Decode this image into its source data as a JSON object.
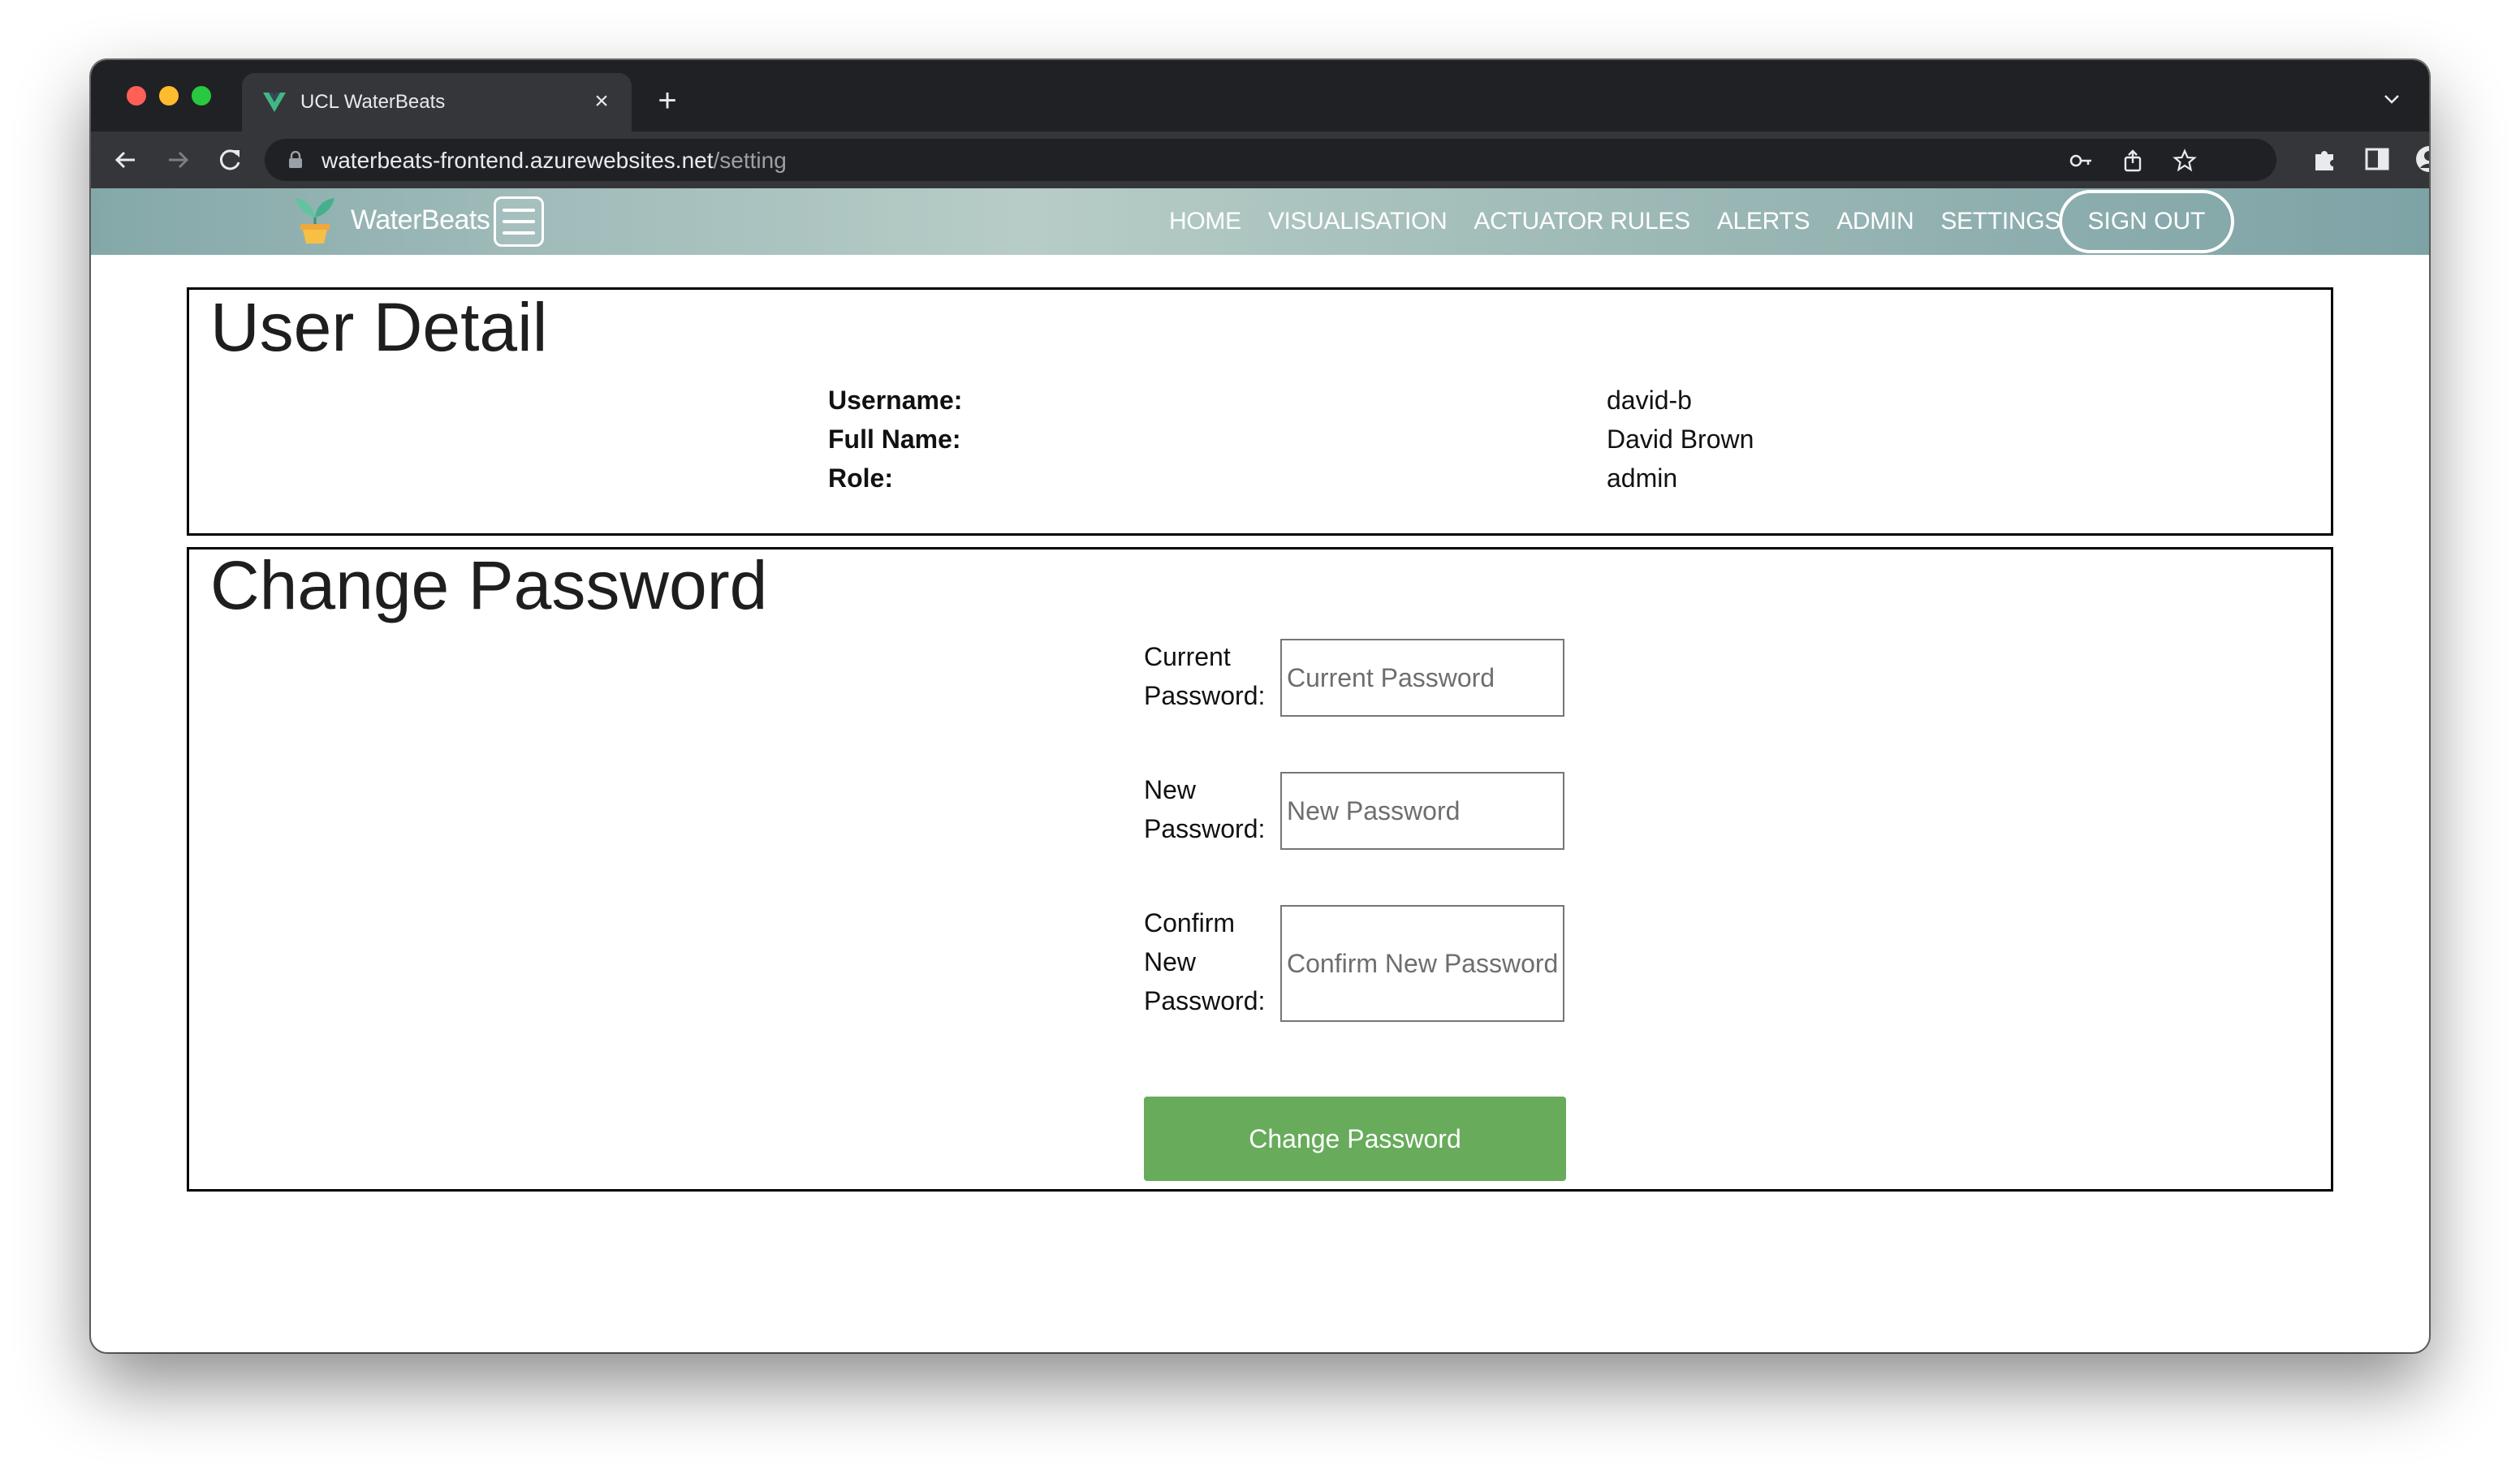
{
  "browser": {
    "tab_title": "UCL WaterBeats",
    "tab_close": "×",
    "new_tab": "+",
    "url_host": "waterbeats-frontend.azurewebsites.net",
    "url_path": "/setting"
  },
  "navbar": {
    "brand": "WaterBeats",
    "links": [
      "HOME",
      "VISUALISATION",
      "ACTUATOR RULES",
      "ALERTS",
      "ADMIN",
      "SETTINGS"
    ],
    "signout_label": "SIGN OUT"
  },
  "user_detail": {
    "title": "User Detail",
    "rows": [
      {
        "label": "Username:",
        "value": "david-b"
      },
      {
        "label": "Full Name:",
        "value": "David Brown"
      },
      {
        "label": "Role:",
        "value": "admin"
      }
    ]
  },
  "change_password": {
    "title": "Change Password",
    "current_label_1": "Current",
    "current_label_2": "Password:",
    "current_placeholder": "Current Password",
    "new_label_1": "New",
    "new_label_2": "Password:",
    "new_placeholder": "New Password",
    "confirm_label_1": "Confirm",
    "confirm_label_2": "New",
    "confirm_label_3": "Password:",
    "confirm_placeholder": "Confirm New Password",
    "submit_label": "Change Password"
  },
  "colors": {
    "submit_button": "#67ab5b",
    "tab_bar": "#202124",
    "toolbar": "#35363a"
  }
}
